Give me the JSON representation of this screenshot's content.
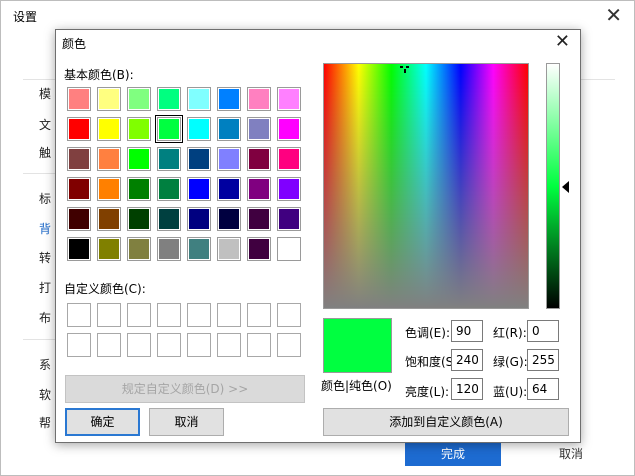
{
  "settings_window": {
    "title": "设置",
    "close": "✕",
    "items": [
      "模",
      "文",
      "触",
      "标",
      "背",
      "转",
      "打",
      "布",
      "系",
      "软",
      "帮"
    ],
    "finish_button": "完成",
    "cancel_button": "取消"
  },
  "color_dialog": {
    "title": "颜色",
    "close": "✕",
    "basic_colors_label": "基本颜色(B):",
    "custom_colors_label": "自定义颜色(C):",
    "basic_colors": [
      "#ff8080",
      "#ffff80",
      "#80ff80",
      "#00ff80",
      "#80ffff",
      "#0080ff",
      "#ff80c0",
      "#ff80ff",
      "#ff0000",
      "#ffff00",
      "#80ff00",
      "#00ff40",
      "#00ffff",
      "#0080c0",
      "#8080c0",
      "#ff00ff",
      "#804040",
      "#ff8040",
      "#00ff00",
      "#008080",
      "#004080",
      "#8080ff",
      "#800040",
      "#ff0080",
      "#800000",
      "#ff8000",
      "#008000",
      "#008040",
      "#0000ff",
      "#0000a0",
      "#800080",
      "#8000ff",
      "#400000",
      "#804000",
      "#004000",
      "#004040",
      "#000080",
      "#000040",
      "#400040",
      "#400080",
      "#000000",
      "#808000",
      "#808040",
      "#808080",
      "#408080",
      "#c0c0c0",
      "#400040",
      "#ffffff"
    ],
    "selected_basic_index": 11,
    "define_custom_button": "规定自定义颜色(D) >>",
    "ok_button": "确定",
    "cancel_button": "取消",
    "preview_color": "#00ff40",
    "color_solid_label": "颜色|纯色(O)",
    "hue_label": "色调(E):",
    "hue_value": "90",
    "sat_label": "饱和度(S):",
    "sat_value": "240",
    "lum_label": "亮度(L):",
    "lum_value": "120",
    "red_label": "红(R):",
    "red_value": "0",
    "green_label": "绿(G):",
    "green_value": "255",
    "blue_label": "蓝(U):",
    "blue_value": "64",
    "add_custom_button": "添加到自定义颜色(A)"
  }
}
